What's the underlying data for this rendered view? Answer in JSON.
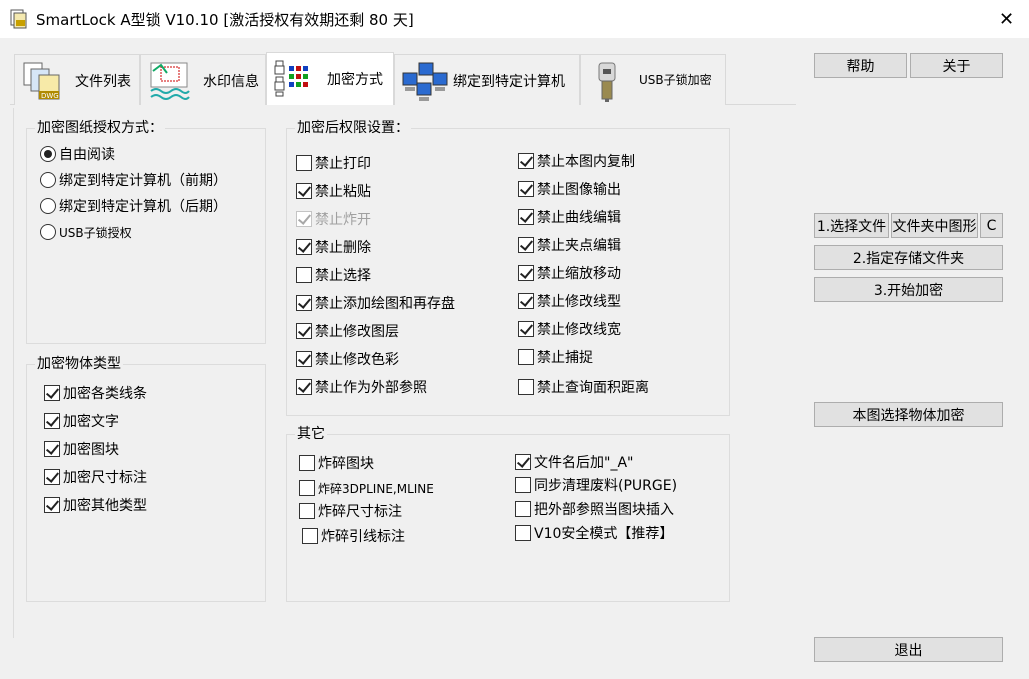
{
  "window": {
    "title": "SmartLock A型锁  V10.10 [激活授权有效期还剩 80 天]",
    "close_symbol": "✕"
  },
  "tabs": [
    {
      "label": "文件列表",
      "icon": "dwg-files-icon"
    },
    {
      "label": "水印信息",
      "icon": "watermark-icon"
    },
    {
      "label": "加密方式",
      "icon": "encryption-lock-icon",
      "active": true
    },
    {
      "label": "绑定到特定计算机",
      "icon": "network-computers-icon"
    },
    {
      "label": "USB子锁加密",
      "icon": "usb-key-icon"
    }
  ],
  "auth_group": {
    "title": "加密图纸授权方式：",
    "options": [
      {
        "label": "自由阅读",
        "checked": true
      },
      {
        "label": "绑定到特定计算机（前期）",
        "checked": false
      },
      {
        "label": "绑定到特定计算机（后期）",
        "checked": false
      },
      {
        "label": "USB子锁授权",
        "checked": false
      }
    ]
  },
  "object_group": {
    "title": "加密物体类型",
    "options": [
      {
        "label": "加密各类线条",
        "checked": true
      },
      {
        "label": "加密文字",
        "checked": true
      },
      {
        "label": "加密图块",
        "checked": true
      },
      {
        "label": "加密尺寸标注",
        "checked": true
      },
      {
        "label": "加密其他类型",
        "checked": true
      }
    ]
  },
  "perm_group": {
    "title": "加密后权限设置：",
    "left": [
      {
        "label": "禁止打印",
        "checked": false
      },
      {
        "label": "禁止粘贴",
        "checked": true
      },
      {
        "label": "禁止炸开",
        "checked": true,
        "disabled": true
      },
      {
        "label": "禁止删除",
        "checked": true
      },
      {
        "label": "禁止选择",
        "checked": false
      },
      {
        "label": "禁止添加绘图和再存盘",
        "checked": true
      },
      {
        "label": "禁止修改图层",
        "checked": true
      },
      {
        "label": "禁止修改色彩",
        "checked": true
      },
      {
        "label": "禁止作为外部参照",
        "checked": true
      }
    ],
    "right": [
      {
        "label": "禁止本图内复制",
        "checked": true
      },
      {
        "label": "禁止图像输出",
        "checked": true
      },
      {
        "label": "禁止曲线编辑",
        "checked": true
      },
      {
        "label": "禁止夹点编辑",
        "checked": true
      },
      {
        "label": "禁止缩放移动",
        "checked": true
      },
      {
        "label": "禁止修改线型",
        "checked": true
      },
      {
        "label": "禁止修改线宽",
        "checked": true
      },
      {
        "label": "禁止捕捉",
        "checked": false
      },
      {
        "label": "禁止查询面积距离",
        "checked": false
      }
    ]
  },
  "other_group": {
    "title": "其它",
    "left": [
      {
        "label": "炸碎图块",
        "checked": false
      },
      {
        "label": "炸碎3DPLINE,MLINE",
        "checked": false
      },
      {
        "label": "炸碎尺寸标注",
        "checked": false
      },
      {
        "label": "炸碎引线标注",
        "checked": false
      }
    ],
    "right": [
      {
        "label": "文件名后加\"_A\"",
        "checked": true
      },
      {
        "label": "同步清理废料(PURGE)",
        "checked": false
      },
      {
        "label": "把外部参照当图块插入",
        "checked": false
      },
      {
        "label": "V10安全模式【推荐】",
        "checked": false
      }
    ]
  },
  "buttons": {
    "help": "帮助",
    "about": "关于",
    "select_file": "1.选择文件",
    "folder_drawings": "文件夹中图形",
    "c": "C",
    "save_folder": "2.指定存储文件夹",
    "start": "3.开始加密",
    "object_encrypt": "本图选择物体加密",
    "exit": "退出"
  }
}
